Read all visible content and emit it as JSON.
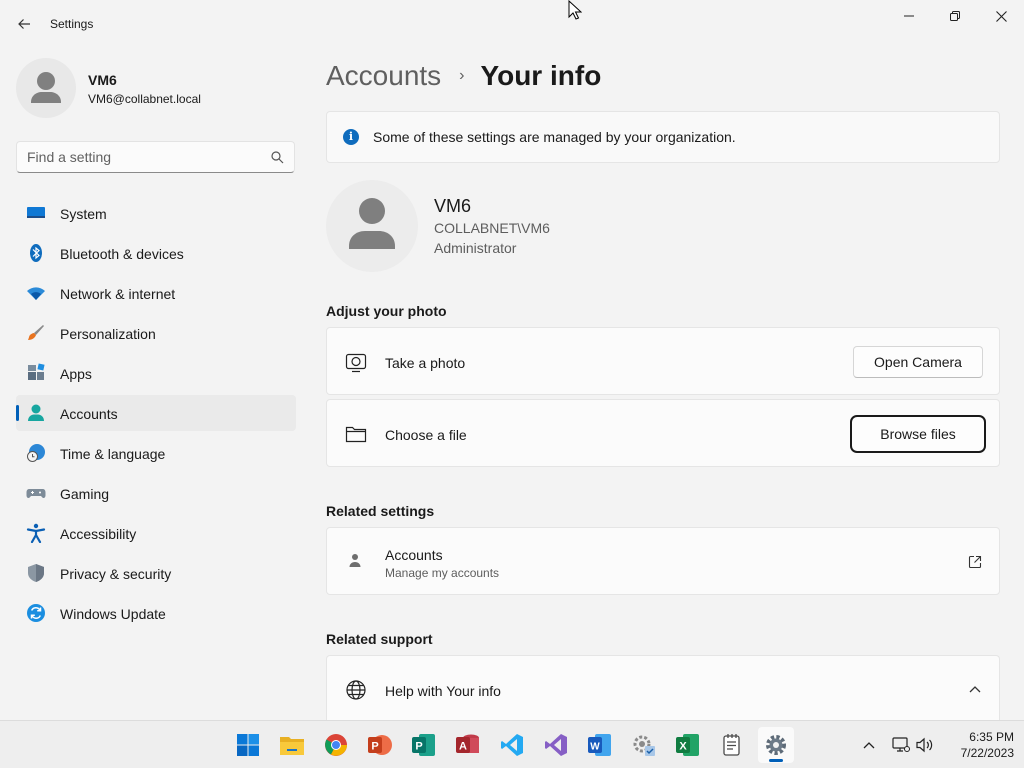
{
  "window": {
    "app_title": "Settings"
  },
  "profile": {
    "name": "VM6",
    "email": "VM6@collabnet.local"
  },
  "search": {
    "placeholder": "Find a setting"
  },
  "nav": {
    "items": [
      {
        "label": "System",
        "icon": "system-monitor-icon"
      },
      {
        "label": "Bluetooth & devices",
        "icon": "bluetooth-icon"
      },
      {
        "label": "Network & internet",
        "icon": "wifi-icon"
      },
      {
        "label": "Personalization",
        "icon": "paintbrush-icon"
      },
      {
        "label": "Apps",
        "icon": "apps-icon"
      },
      {
        "label": "Accounts",
        "icon": "person-icon",
        "active": true
      },
      {
        "label": "Time & language",
        "icon": "globe-clock-icon"
      },
      {
        "label": "Gaming",
        "icon": "gamepad-icon"
      },
      {
        "label": "Accessibility",
        "icon": "accessibility-icon"
      },
      {
        "label": "Privacy & security",
        "icon": "shield-icon"
      },
      {
        "label": "Windows Update",
        "icon": "update-icon"
      }
    ]
  },
  "breadcrumb": {
    "parent": "Accounts",
    "separator": "›",
    "current": "Your info"
  },
  "info_bar": {
    "text": "Some of these settings are managed by your organization."
  },
  "user": {
    "name": "VM6",
    "domain": "COLLABNET\\VM6",
    "role": "Administrator"
  },
  "adjust_photo": {
    "title": "Adjust your photo",
    "take_photo_label": "Take a photo",
    "open_camera_button": "Open Camera",
    "choose_file_label": "Choose a file",
    "browse_files_button": "Browse files"
  },
  "related_settings": {
    "title": "Related settings",
    "accounts_label": "Accounts",
    "accounts_sub": "Manage my accounts"
  },
  "related_support": {
    "title": "Related support",
    "help_label": "Help with Your info"
  },
  "taskbar": {
    "apps": [
      "start",
      "file-explorer",
      "chrome",
      "powerpoint",
      "publisher",
      "access",
      "visual-studio-code",
      "visual-studio",
      "word",
      "control-panel",
      "excel",
      "notepad",
      "settings"
    ],
    "time": "6:35 PM",
    "date": "7/22/2023"
  },
  "colors": {
    "accent": "#005fb8",
    "background": "#f3f3f3",
    "card": "#fbfbfb"
  }
}
